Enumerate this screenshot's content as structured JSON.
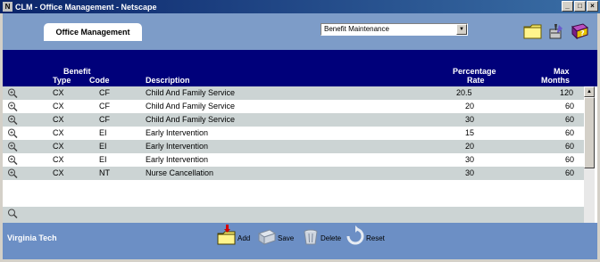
{
  "window": {
    "title": "CLM - Office Management - Netscape",
    "app_glyph": "N",
    "min_glyph": "_",
    "max_glyph": "□",
    "close_glyph": "×"
  },
  "header": {
    "tab_label": "Office Management",
    "select_value": "Benefit   Maintenance",
    "icons": [
      "folder-icon",
      "tools-icon",
      "help-book-icon"
    ]
  },
  "columns": {
    "benefit_group": "Benefit",
    "type": "Type",
    "code": "Code",
    "description": "Description",
    "percentage_line1": "Percentage",
    "percentage_line2": "Rate",
    "max_line1": "Max",
    "max_line2": "Months"
  },
  "rows": [
    {
      "type": "CX",
      "code": "CF",
      "description": "Child And Family Service",
      "rate": "20.5",
      "months": "120"
    },
    {
      "type": "CX",
      "code": "CF",
      "description": "Child And Family Service",
      "rate": "20",
      "months": "60"
    },
    {
      "type": "CX",
      "code": "CF",
      "description": "Child And Family Service",
      "rate": "30",
      "months": "60"
    },
    {
      "type": "CX",
      "code": "EI",
      "description": "Early Intervention",
      "rate": "15",
      "months": "60"
    },
    {
      "type": "CX",
      "code": "EI",
      "description": "Early Intervention",
      "rate": "20",
      "months": "60"
    },
    {
      "type": "CX",
      "code": "EI",
      "description": "Early Intervention",
      "rate": "30",
      "months": "60"
    },
    {
      "type": "CX",
      "code": "NT",
      "description": "Nurse Cancellation",
      "rate": "30",
      "months": "60"
    }
  ],
  "footer": {
    "org": "Virginia Tech",
    "add": "Add",
    "save": "Save",
    "delete": "Delete",
    "reset": "Reset"
  },
  "colors": {
    "header_blue": "#7d9cc8",
    "navy": "#00007a",
    "row_alt": "#ccd4d4",
    "footer_blue": "#6c8fc5"
  }
}
